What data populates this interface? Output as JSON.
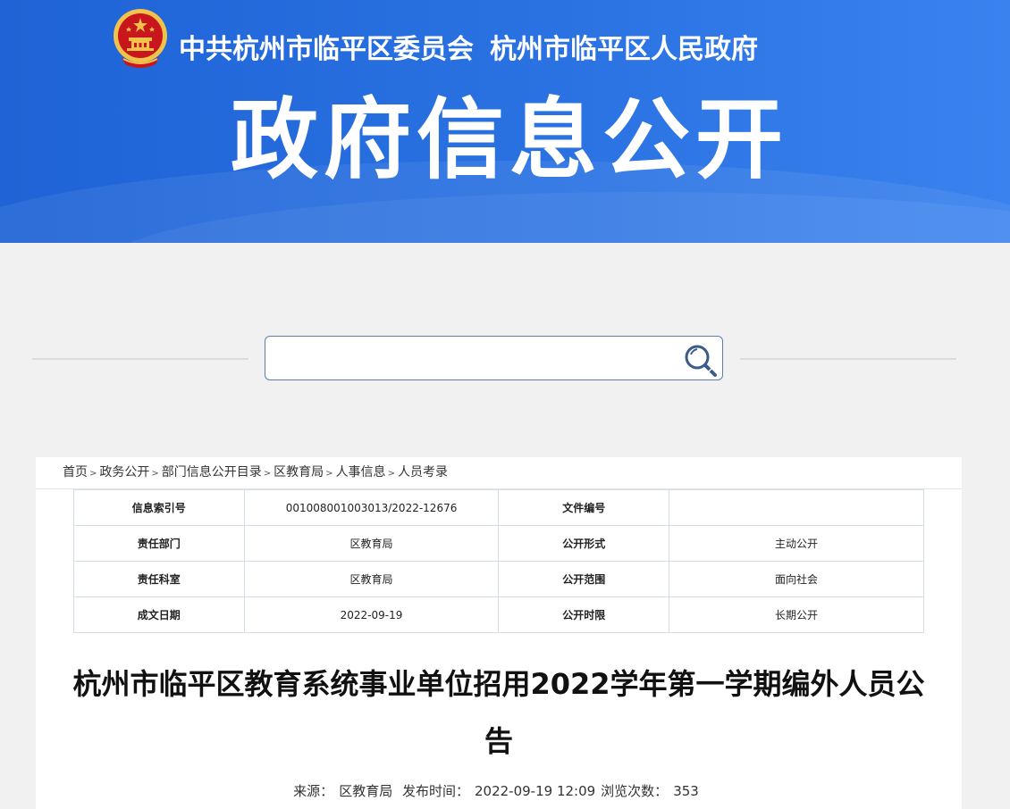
{
  "header": {
    "org_party": "中共杭州市临平区委员会",
    "org_gov": "杭州市临平区人民政府",
    "site_title": "政府信息公开",
    "colors": {
      "banner": "#2a72e2",
      "emblem_red": "#c8161d",
      "emblem_gold": "#f3c24a"
    }
  },
  "search": {
    "placeholder": "",
    "value": ""
  },
  "breadcrumb": [
    "首页",
    "政务公开",
    "部门信息公开目录",
    "区教育局",
    "人事信息",
    "人员考录"
  ],
  "breadcrumb_sep": ">",
  "meta": [
    {
      "k1": "信息索引号",
      "v1": "001008001003013/2022-12676",
      "k2": "文件编号",
      "v2": ""
    },
    {
      "k1": "责任部门",
      "v1": "区教育局",
      "k2": "公开形式",
      "v2": "主动公开"
    },
    {
      "k1": "责任科室",
      "v1": "区教育局",
      "k2": "公开范围",
      "v2": "面向社会"
    },
    {
      "k1": "成文日期",
      "v1": "2022-09-19",
      "k2": "公开时限",
      "v2": "长期公开"
    }
  ],
  "article": {
    "title": "杭州市临平区教育系统事业单位招用2022学年第一学期编外人员公告",
    "source_label": "来源：",
    "source": "区教育局",
    "publish_label": "发布时间：",
    "publish_time": "2022-09-19 12:09",
    "views_label": "浏览次数：",
    "views": "353"
  }
}
